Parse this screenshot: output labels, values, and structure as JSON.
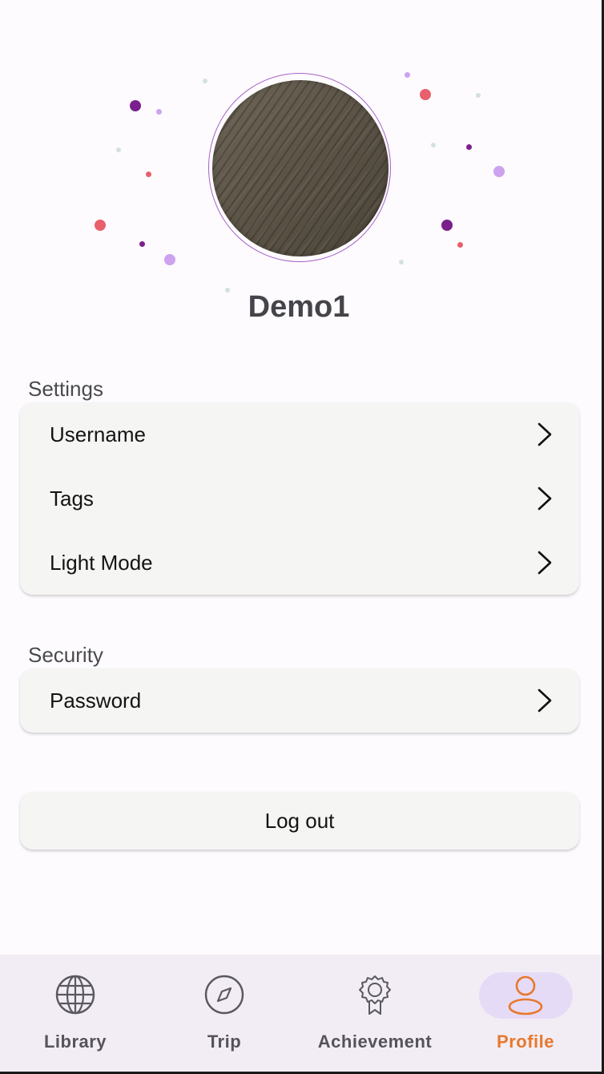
{
  "profile": {
    "username": "Demo1",
    "avatar_alt": "wood texture avatar"
  },
  "settings": {
    "title": "Settings",
    "items": [
      {
        "label": "Username"
      },
      {
        "label": "Tags"
      },
      {
        "label": "Light Mode"
      }
    ]
  },
  "security": {
    "title": "Security",
    "items": [
      {
        "label": "Password"
      }
    ]
  },
  "logout_label": "Log out",
  "nav": {
    "items": [
      {
        "label": "Library",
        "icon": "globe-icon"
      },
      {
        "label": "Trip",
        "icon": "compass-icon"
      },
      {
        "label": "Achievement",
        "icon": "badge-icon"
      },
      {
        "label": "Profile",
        "icon": "person-icon"
      }
    ],
    "active": "Profile"
  },
  "colors": {
    "accent": "#e8782b",
    "nav_bg": "#f2edf5",
    "nav_pill": "#e6dbf6",
    "avatar_ring": "#a660c8"
  }
}
